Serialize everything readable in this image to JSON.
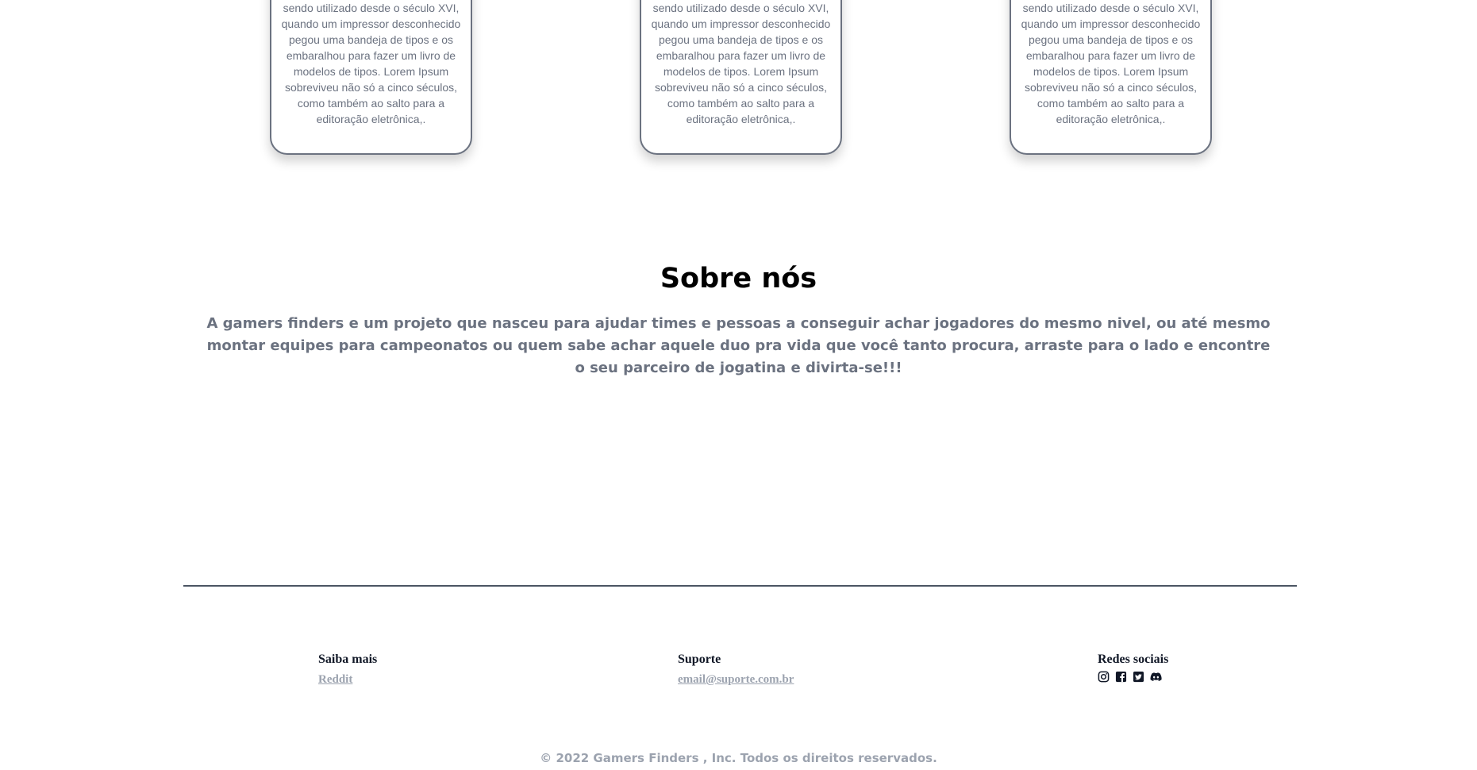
{
  "cards": [
    {
      "text": "sendo utilizado desde o século XVI, quando um impressor desconhecido pegou uma bandeja de tipos e os embaralhou para fazer um livro de modelos de tipos. Lorem Ipsum sobreviveu não só a cinco séculos, como também ao salto para a editoração eletrônica,."
    },
    {
      "text": "sendo utilizado desde o século XVI, quando um impressor desconhecido pegou uma bandeja de tipos e os embaralhou para fazer um livro de modelos de tipos. Lorem Ipsum sobreviveu não só a cinco séculos, como também ao salto para a editoração eletrônica,."
    },
    {
      "text": "sendo utilizado desde o século XVI, quando um impressor desconhecido pegou uma bandeja de tipos e os embaralhou para fazer um livro de modelos de tipos. Lorem Ipsum sobreviveu não só a cinco séculos, como também ao salto para a editoração eletrônica,."
    }
  ],
  "about": {
    "title": "Sobre nós",
    "text": "A gamers finders e um projeto que nasceu para ajudar times e pessoas a conseguir achar jogadores do mesmo nivel, ou até mesmo montar equipes para campeonatos ou quem sabe achar aquele duo pra vida que você tanto procura, arraste para o lado e encontre o seu parceiro de jogatina e divirta-se!!!"
  },
  "footer": {
    "learn_more": {
      "heading": "Saiba mais",
      "link": "Reddit"
    },
    "support": {
      "heading": "Suporte",
      "link": "email@suporte.com.br"
    },
    "social": {
      "heading": "Redes sociais",
      "icons": [
        "instagram-icon",
        "facebook-icon",
        "twitter-icon",
        "discord-icon"
      ]
    },
    "copyright": "© 2022 Gamers Finders , Inc. Todos os direitos reservados."
  },
  "colors": {
    "text_muted": "#6b7280",
    "link": "#9ca3af",
    "heading": "#111827",
    "divider": "#4b5563"
  }
}
